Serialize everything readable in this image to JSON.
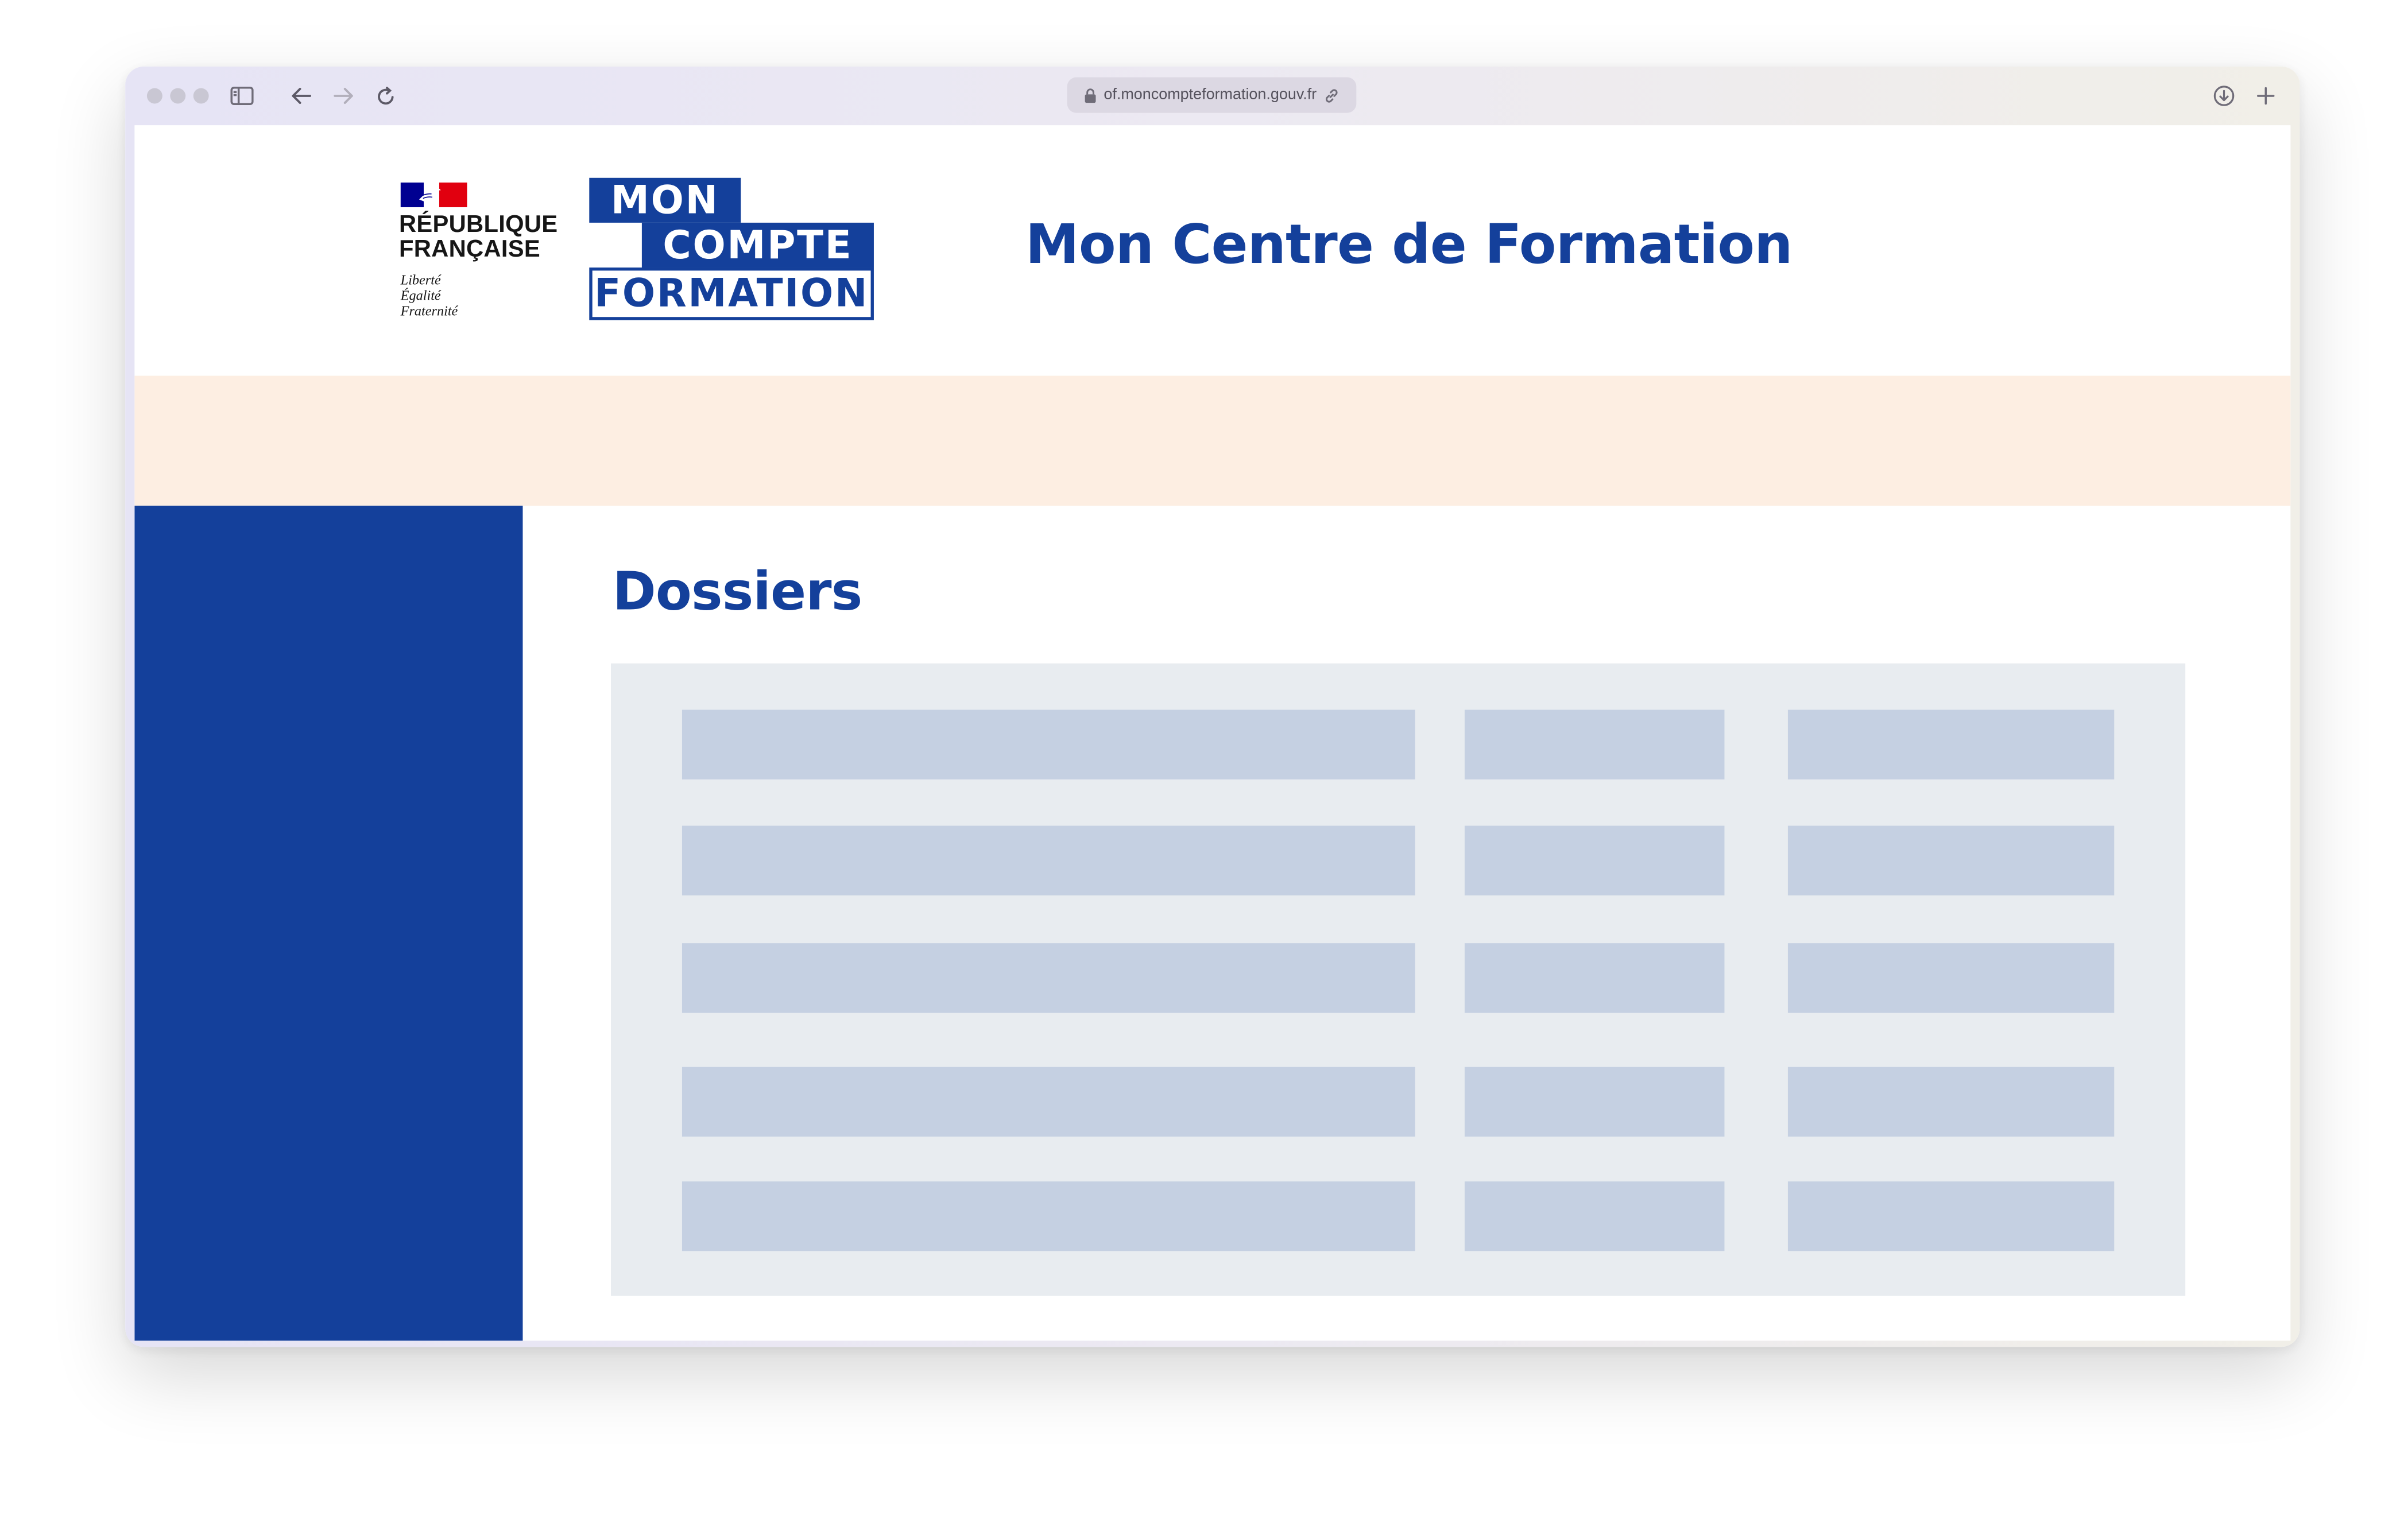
{
  "browser": {
    "url": "of.moncompteformation.gouv.fr"
  },
  "header": {
    "rf_line1": "RÉPUBLIQUE",
    "rf_line2": "FRANÇAISE",
    "motto1": "Liberté",
    "motto2": "Égalité",
    "motto3": "Fraternité",
    "mcf_mon": "MON",
    "mcf_compte": "COMPTE",
    "mcf_formation": "FORMATION",
    "site_title": "Mon Centre de Formation"
  },
  "main": {
    "title": "Dossiers",
    "table_rows": 5,
    "table_columns": 3
  },
  "colors": {
    "brand_blue": "#14409b",
    "banner": "#fdeee2",
    "table_bg": "#e8ecf0",
    "placeholder": "#c5d0e2",
    "marianne_red": "#e1000f"
  }
}
